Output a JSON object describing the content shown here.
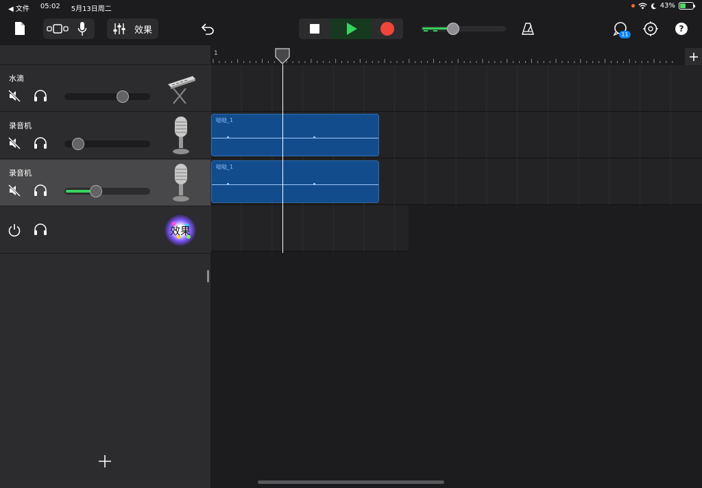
{
  "status_bar": {
    "back_label": "◀ 文件",
    "time": "05:02",
    "date": "5月13日周二",
    "battery": "43%",
    "battery_level": 0.43
  },
  "toolbar": {
    "effects_label": "效果",
    "notification_count": "11",
    "help_label": "?",
    "master_volume_level": 0.38
  },
  "tracks": [
    {
      "name": "水滴",
      "instrument": "keyboard",
      "volume": 0.68,
      "selected": false
    },
    {
      "name": "录音机",
      "instrument": "microphone",
      "volume": 0.16,
      "selected": false
    },
    {
      "name": "录音机",
      "instrument": "microphone",
      "volume": 0.37,
      "selected": true
    },
    {
      "name": "",
      "instrument": "effects",
      "effects_label": "效果",
      "selected": false
    }
  ],
  "timeline": {
    "ruler_start": "1",
    "regions": [
      {
        "lane": 1,
        "name": "哒哒_1"
      },
      {
        "lane": 2,
        "name": "哒哒_1"
      }
    ]
  },
  "colors": {
    "accent_green": "#37d45c",
    "record_red": "#f0453a",
    "region_blue": "#134c8c",
    "badge_blue": "#0a84ff"
  }
}
